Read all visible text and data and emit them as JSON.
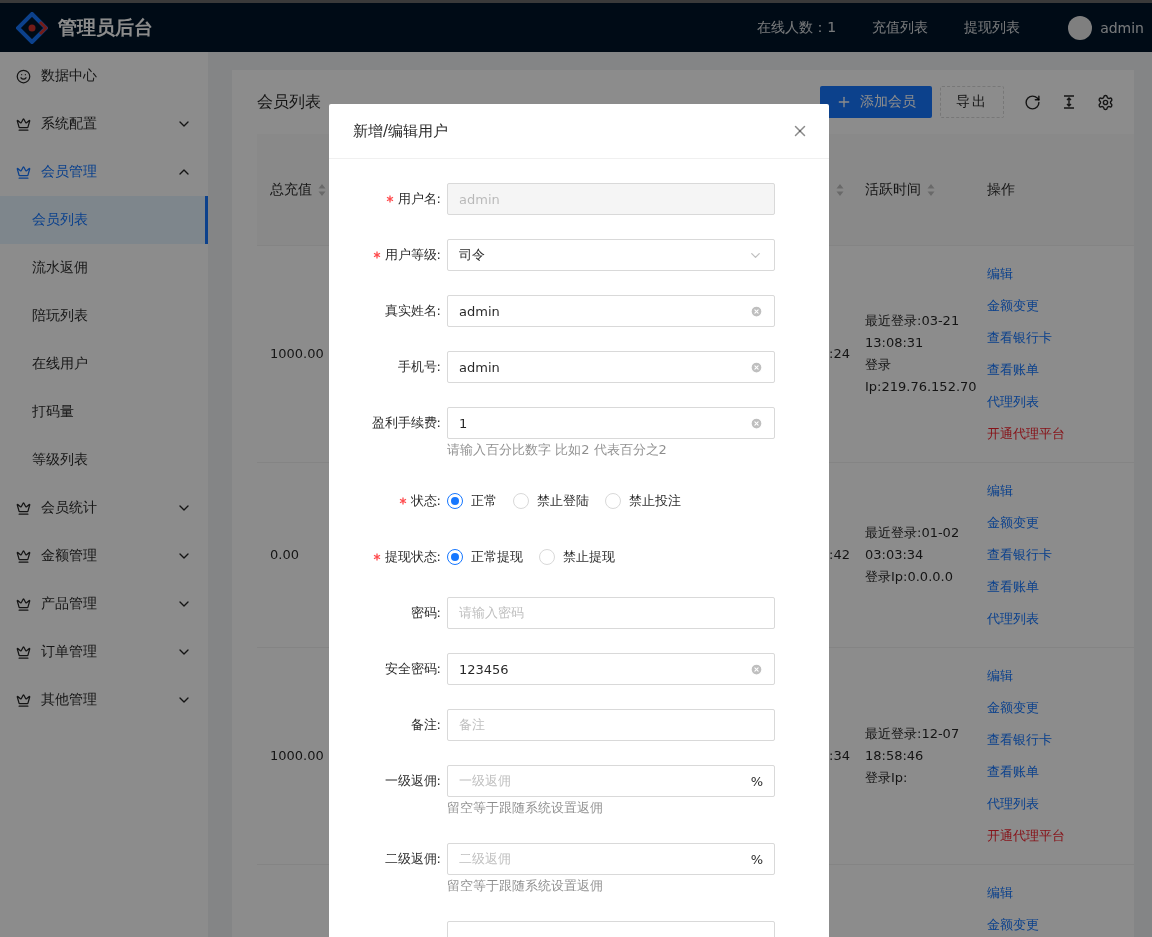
{
  "header": {
    "title": "管理员后台",
    "online": "在线人数：1",
    "links": [
      "充值列表",
      "提现列表"
    ],
    "user": "admin"
  },
  "sidebar": {
    "items": [
      {
        "label": "数据中心",
        "kind": "leaf"
      },
      {
        "label": "系统配置",
        "kind": "group",
        "expanded": false
      },
      {
        "label": "会员管理",
        "kind": "group",
        "expanded": true,
        "children": [
          {
            "label": "会员列表",
            "selected": true
          },
          {
            "label": "流水返佣",
            "selected": false
          },
          {
            "label": "陪玩列表",
            "selected": false
          },
          {
            "label": "在线用户",
            "selected": false
          },
          {
            "label": "打码量",
            "selected": false
          },
          {
            "label": "等级列表",
            "selected": false
          }
        ]
      },
      {
        "label": "会员统计",
        "kind": "group",
        "expanded": false
      },
      {
        "label": "金额管理",
        "kind": "group",
        "expanded": false
      },
      {
        "label": "产品管理",
        "kind": "group",
        "expanded": false
      },
      {
        "label": "订单管理",
        "kind": "group",
        "expanded": false
      },
      {
        "label": "其他管理",
        "kind": "group",
        "expanded": false
      }
    ]
  },
  "card": {
    "title": "会员列表",
    "add_button": "添加会员",
    "export_button": "导出",
    "table": {
      "columns": [
        {
          "label": "总充值",
          "sortable": true
        },
        {
          "sortable": true
        },
        {
          "label": "活跃时间",
          "sortable": true
        },
        {
          "label": "操作",
          "sortable": false
        }
      ],
      "rows": [
        {
          "total": "1000.00",
          "column_2": ":24",
          "active_lines": [
            "最近登录:03-21",
            "13:08:31",
            "登录",
            "Ip:219.76.152.70"
          ],
          "actions": [
            {
              "label": "编辑",
              "kind": "link"
            },
            {
              "label": "金额变更",
              "kind": "link"
            },
            {
              "label": "查看银行卡",
              "kind": "link"
            },
            {
              "label": "查看账单",
              "kind": "link"
            },
            {
              "label": "代理列表",
              "kind": "link"
            },
            {
              "label": "开通代理平台",
              "kind": "danger"
            }
          ]
        },
        {
          "total": "0.00",
          "column_2": ":42",
          "active_lines": [
            "最近登录:01-02",
            "03:03:34",
            "登录Ip:0.0.0.0"
          ],
          "actions": [
            {
              "label": "编辑",
              "kind": "link"
            },
            {
              "label": "金额变更",
              "kind": "link"
            },
            {
              "label": "查看银行卡",
              "kind": "link"
            },
            {
              "label": "查看账单",
              "kind": "link"
            },
            {
              "label": "代理列表",
              "kind": "link"
            }
          ]
        },
        {
          "total": "1000.00",
          "column_2": ":34",
          "active_lines": [
            "最近登录:12-07",
            "18:58:46",
            "登录Ip:"
          ],
          "actions": [
            {
              "label": "编辑",
              "kind": "link"
            },
            {
              "label": "金额变更",
              "kind": "link"
            },
            {
              "label": "查看银行卡",
              "kind": "link"
            },
            {
              "label": "查看账单",
              "kind": "link"
            },
            {
              "label": "代理列表",
              "kind": "link"
            },
            {
              "label": "开通代理平台",
              "kind": "danger"
            }
          ]
        },
        {
          "actions": [
            {
              "label": "编辑",
              "kind": "link"
            },
            {
              "label": "金额变更",
              "kind": "link"
            }
          ]
        }
      ]
    }
  },
  "modal": {
    "title": "新增/编辑用户",
    "fields": [
      {
        "label": "用户名:",
        "kind": "input",
        "required": true,
        "disabled": true,
        "value": "admin"
      },
      {
        "label": "用户等级:",
        "kind": "select",
        "required": true,
        "value": "司令"
      },
      {
        "label": "真实姓名:",
        "kind": "input",
        "required": false,
        "clearable": true,
        "value": "admin"
      },
      {
        "label": "手机号:",
        "kind": "input",
        "required": false,
        "clearable": true,
        "value": "admin"
      },
      {
        "label": "盈利手续费:",
        "kind": "input",
        "required": false,
        "clearable": true,
        "value": "1",
        "hint": "请输入百分比数字 比如2 代表百分之2"
      },
      {
        "label": "状态:",
        "kind": "radio",
        "required": true,
        "options": [
          {
            "label": "正常",
            "selected": true
          },
          {
            "label": "禁止登陆",
            "selected": false
          },
          {
            "label": "禁止投注",
            "selected": false
          }
        ]
      },
      {
        "label": "提现状态:",
        "kind": "radio",
        "required": true,
        "options": [
          {
            "label": "正常提现",
            "selected": true
          },
          {
            "label": "禁止提现",
            "selected": false
          }
        ]
      },
      {
        "label": "密码:",
        "kind": "input",
        "required": false,
        "placeholder": "请输入密码"
      },
      {
        "label": "安全密码:",
        "kind": "input",
        "required": false,
        "clearable": true,
        "value": "123456"
      },
      {
        "label": "备注:",
        "kind": "input",
        "required": false,
        "placeholder": "备注"
      },
      {
        "label": "一级返佣:",
        "kind": "input",
        "required": false,
        "placeholder": "一级返佣",
        "suffix": "%",
        "hint": "留空等于跟随系统设置返佣"
      },
      {
        "label": "二级返佣:",
        "kind": "input",
        "required": false,
        "placeholder": "二级返佣",
        "suffix": "%",
        "hint": "留空等于跟随系统设置返佣"
      },
      {
        "kind": "input",
        "required": false
      }
    ]
  }
}
